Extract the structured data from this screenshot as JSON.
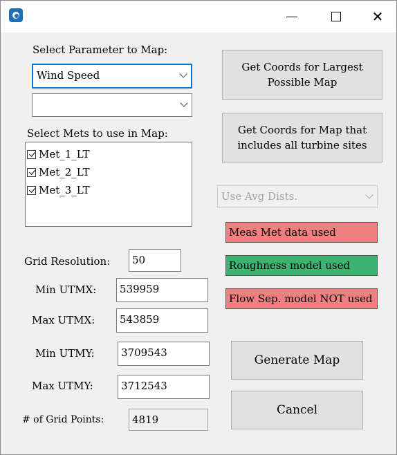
{
  "window": {
    "minimize_glyph": "",
    "close_glyph": "✕"
  },
  "left": {
    "select_parameter_label": "Select Parameter to Map:",
    "parameter_combo_value": "Wind Speed",
    "secondary_combo_value": "",
    "select_mets_label": "Select Mets to use in Map:",
    "mets": [
      {
        "label": "Met_1_LT",
        "checked": true
      },
      {
        "label": "Met_2_LT",
        "checked": true
      },
      {
        "label": "Met_3_LT",
        "checked": true
      }
    ],
    "grid_resolution_label": "Grid Resolution:",
    "grid_resolution_value": "50",
    "min_utmx_label": "Min UTMX:",
    "min_utmx_value": "539959",
    "max_utmx_label": "Max UTMX:",
    "max_utmx_value": "543859",
    "min_utmy_label": "Min UTMY:",
    "min_utmy_value": "3709543",
    "max_utmy_label": "Max UTMY:",
    "max_utmy_value": "3712543",
    "grid_points_label": "# of Grid Points:",
    "grid_points_value": "4819"
  },
  "right": {
    "largest_map_button": "Get Coords for Largest Possible Map",
    "turbine_map_button": "Get Coords for Map that includes all turbine sites",
    "avg_dists_combo_value": "Use Avg Dists.",
    "status_meas_met": "Meas Met data used",
    "status_roughness": "Roughness model used",
    "status_flow_sep": "Flow Sep. model NOT used",
    "generate_button": "Generate Map",
    "cancel_button": "Cancel"
  },
  "colors": {
    "status_red": "#f08080",
    "status_green": "#3cb371",
    "focus_border": "#0078d7",
    "app_icon": "#1e6fb8"
  }
}
